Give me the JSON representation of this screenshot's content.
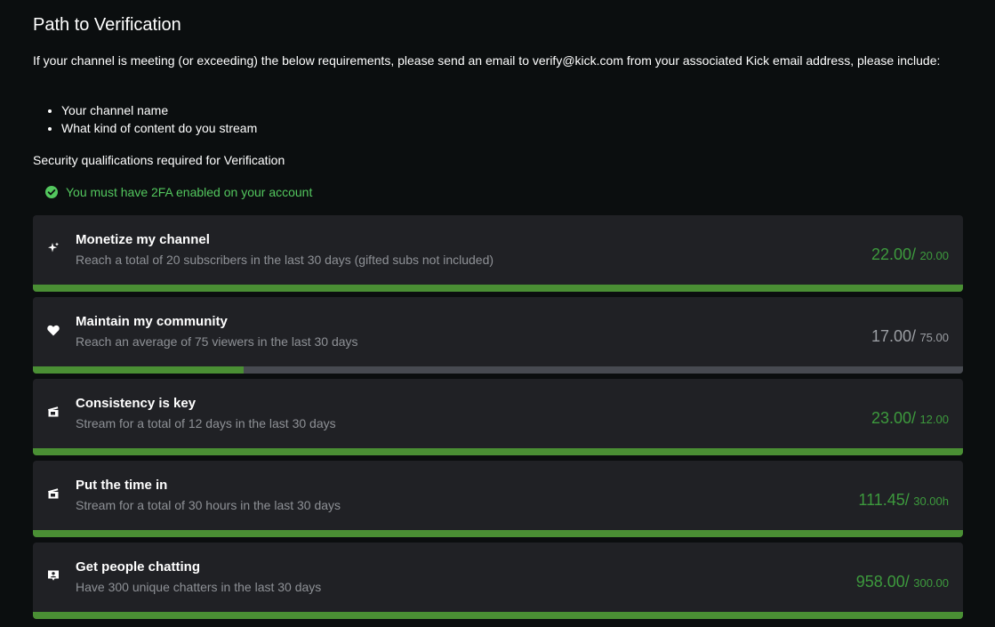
{
  "page": {
    "title": "Path to Verification",
    "intro": "If your channel is meeting (or exceeding) the below requirements, please send an email to verify@kick.com from your associated Kick email address, please include:",
    "bullets": [
      "Your channel name",
      "What kind of content do you stream"
    ],
    "security_heading": "Security qualifications required for Verification",
    "twofa_text": "You must have 2FA enabled on your account",
    "twofa_icon": "check-circle-icon"
  },
  "colors": {
    "accent_green": "#53c75e",
    "progress_green": "#4a8f34",
    "card_bg": "#202125",
    "page_bg": "#0b0e0f"
  },
  "requirements": [
    {
      "icon": "sparkle-icon",
      "title": "Monetize my channel",
      "description": "Reach a total of 20 subscribers in the last 30 days (gifted subs not included)",
      "current": "22.00/",
      "target": "20.00",
      "progress": 1.0,
      "met": true
    },
    {
      "icon": "heart-icon",
      "title": "Maintain my community",
      "description": "Reach an average of 75 viewers in the last 30 days",
      "current": "17.00/",
      "target": "75.00",
      "progress": 0.2267,
      "met": false
    },
    {
      "icon": "clapperboard-icon",
      "title": "Consistency is key",
      "description": "Stream for a total of 12 days in the last 30 days",
      "current": "23.00/",
      "target": "12.00",
      "progress": 1.0,
      "met": true
    },
    {
      "icon": "clapperboard-icon",
      "title": "Put the time in",
      "description": "Stream for a total of 30 hours in the last 30 days",
      "current": "111.45/",
      "target": "30.00h",
      "progress": 1.0,
      "met": true
    },
    {
      "icon": "chat-user-icon",
      "title": "Get people chatting",
      "description": "Have 300 unique chatters in the last 30 days",
      "current": "958.00/",
      "target": "300.00",
      "progress": 1.0,
      "met": true
    }
  ]
}
